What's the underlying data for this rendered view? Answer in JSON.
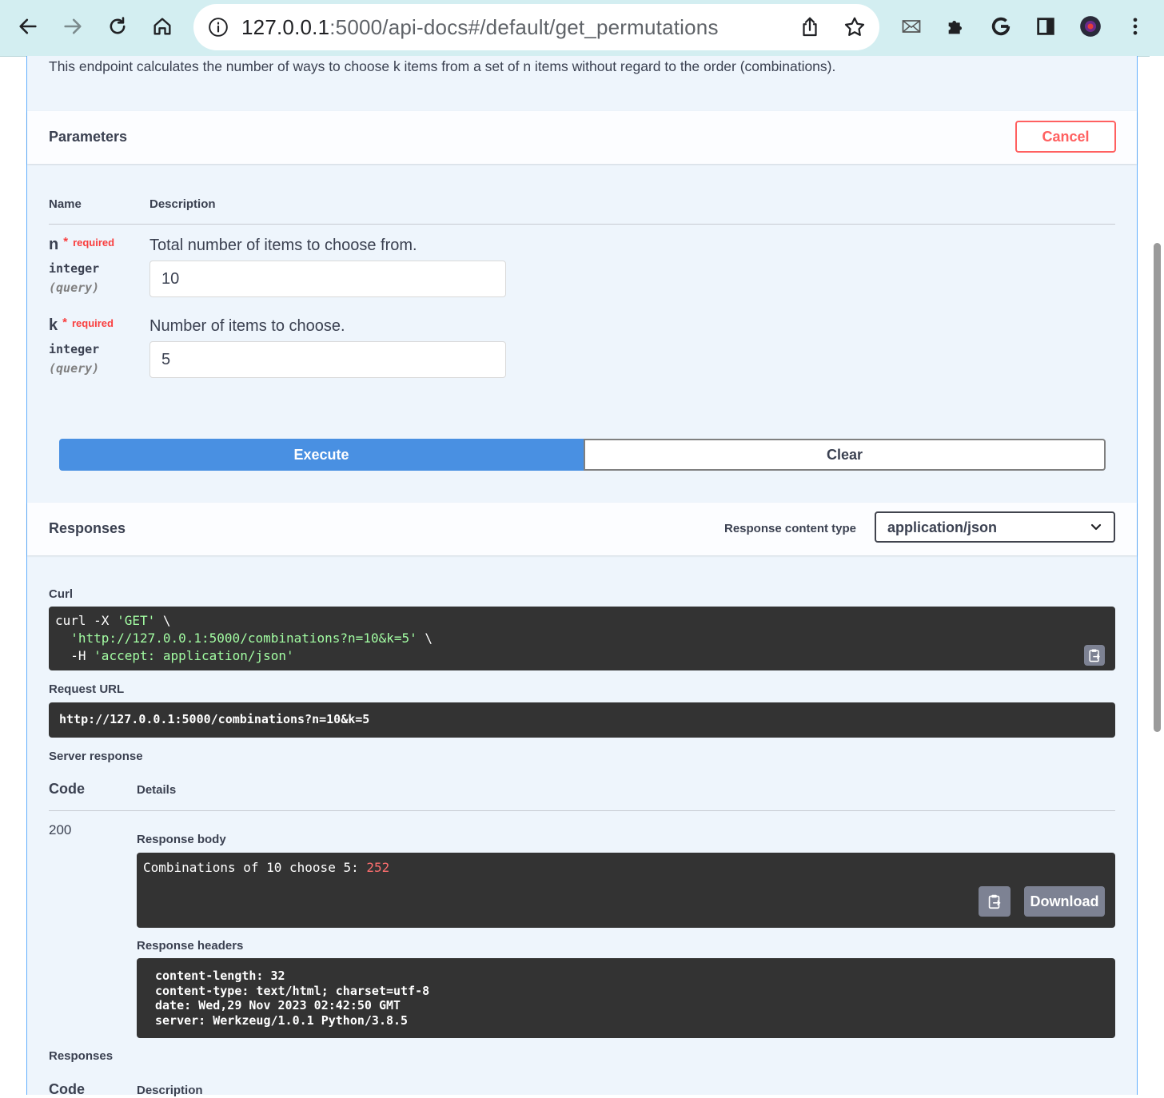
{
  "browser": {
    "url_host": "127.0.0.1",
    "url_rest": ":5000/api-docs#/default/get_permutations"
  },
  "operation": {
    "description": "This endpoint calculates the number of ways to choose k items from a set of n items without regard to the order (combinations)."
  },
  "parameters": {
    "title": "Parameters",
    "cancel_label": "Cancel",
    "col_name": "Name",
    "col_description": "Description",
    "required_label": "required",
    "items": [
      {
        "name": "n",
        "star": "*",
        "type": "integer",
        "in": "(query)",
        "description": "Total number of items to choose from.",
        "value": "10"
      },
      {
        "name": "k",
        "star": "*",
        "type": "integer",
        "in": "(query)",
        "description": "Number of items to choose.",
        "value": "5"
      }
    ],
    "execute_label": "Execute",
    "clear_label": "Clear"
  },
  "responses": {
    "title": "Responses",
    "content_type_label": "Response content type",
    "content_type_value": "application/json",
    "curl_label": "Curl",
    "curl": {
      "l1_a": "curl -X ",
      "l1_b": "'GET'",
      "l1_c": " \\",
      "l2_a": "  ",
      "l2_b": "'http://127.0.0.1:5000/combinations?n=10&k=5'",
      "l2_c": " \\",
      "l3_a": "  -H ",
      "l3_b": "'accept: application/json'"
    },
    "request_url_label": "Request URL",
    "request_url": "http://127.0.0.1:5000/combinations?n=10&k=5",
    "server_response_label": "Server response",
    "code_label": "Code",
    "details_label": "Details",
    "code": "200",
    "response_body_label": "Response body",
    "response_body_text": "Combinations of 10 choose 5: ",
    "response_body_value": "252",
    "download_label": "Download",
    "response_headers_label": "Response headers",
    "headers": [
      "content-length: 32",
      "content-type: text/html; charset=utf-8",
      "date: Wed,29 Nov 2023 02:42:50 GMT",
      "server: Werkzeug/1.0.1 Python/3.8.5"
    ],
    "footer_title": "Responses",
    "footer_code": "Code",
    "footer_description": "Description"
  },
  "colors": {
    "accent_blue": "#4990e2",
    "cancel_red": "#ff6060",
    "panel_bg": "#eef5fc",
    "toolbar_bg": "#d3eef1"
  },
  "icons": [
    "back-arrow-icon",
    "forward-arrow-icon",
    "reload-icon",
    "home-icon",
    "info-icon",
    "share-icon",
    "star-icon",
    "mail-icon",
    "extension-puzzle-icon",
    "google-g-icon",
    "side-panel-icon",
    "profile-avatar-icon",
    "more-vert-icon",
    "chevron-down-icon",
    "copy-clipboard-icon"
  ]
}
